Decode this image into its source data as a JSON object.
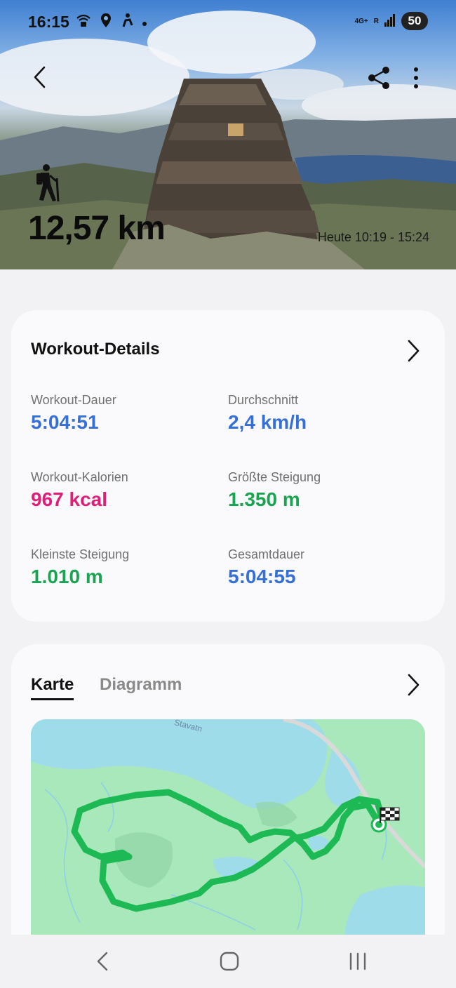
{
  "status_bar": {
    "time": "16:15",
    "network": "4G+",
    "roaming": "R",
    "battery": "50"
  },
  "hero": {
    "distance": "12,57 km",
    "time_range": "Heute 10:19 - 15:24",
    "activity_icon": "hiking-icon"
  },
  "workout_details": {
    "title": "Workout-Details",
    "stats": [
      {
        "label": "Workout-Dauer",
        "value": "5:04:51",
        "color": "#3670d6"
      },
      {
        "label": "Durchschnitt",
        "value": "2,4 km/h",
        "color": "#3670d6"
      },
      {
        "label": "Workout-Kalorien",
        "value": "967 kcal",
        "color": "#e01e78"
      },
      {
        "label": "Größte Steigung",
        "value": "1.350 m",
        "color": "#1aa451"
      },
      {
        "label": "Kleinste Steigung",
        "value": "1.010 m",
        "color": "#1aa451"
      },
      {
        "label": "Gesamtdauer",
        "value": "5:04:55",
        "color": "#3670d6"
      }
    ]
  },
  "map_card": {
    "tabs": [
      {
        "label": "Karte",
        "active": true
      },
      {
        "label": "Diagramm",
        "active": false
      }
    ],
    "map_place_label": "Stavatn",
    "route_color": "#1db954"
  },
  "nav_bar": {
    "icons": [
      "nav-back-icon",
      "nav-home-icon",
      "nav-recents-icon"
    ]
  }
}
